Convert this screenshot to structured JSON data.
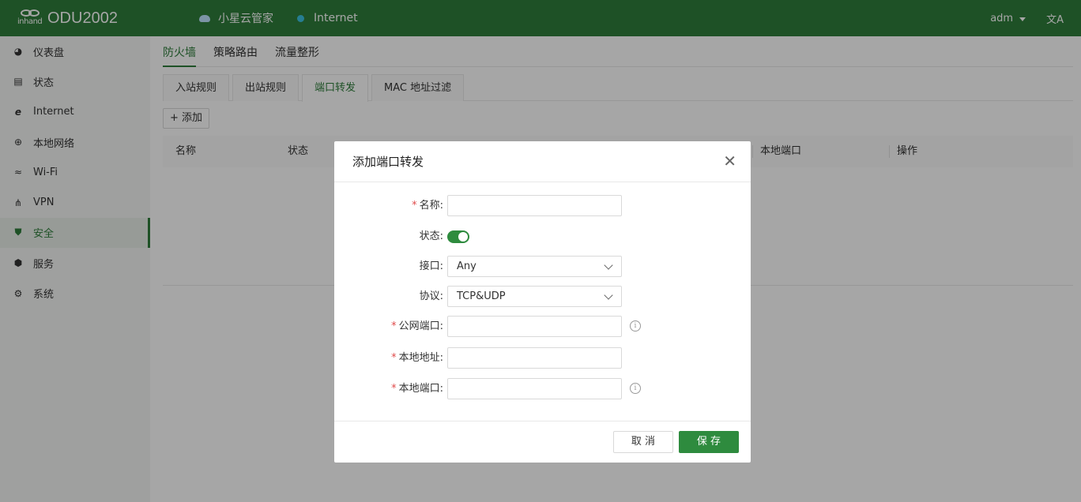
{
  "header": {
    "logo_brand": "inhand",
    "title": "ODU2002",
    "cloud_label": "小星云管家",
    "internet_label": "Internet",
    "user": "adm",
    "lang_icon": "translate-icon"
  },
  "sidebar": {
    "items": [
      {
        "label": "仪表盘",
        "icon": "dashboard-icon"
      },
      {
        "label": "状态",
        "icon": "status-icon"
      },
      {
        "label": "Internet",
        "icon": "internet-icon"
      },
      {
        "label": "本地网络",
        "icon": "globe-icon"
      },
      {
        "label": "Wi-Fi",
        "icon": "wifi-icon"
      },
      {
        "label": "VPN",
        "icon": "vpn-icon"
      },
      {
        "label": "安全",
        "icon": "shield-icon",
        "active": true
      },
      {
        "label": "服务",
        "icon": "cube-icon"
      },
      {
        "label": "系统",
        "icon": "gear-icon"
      }
    ]
  },
  "main": {
    "top_tabs": [
      "防火墙",
      "策略路由",
      "流量整形"
    ],
    "active_top_tab": "防火墙",
    "sub_tabs": [
      "入站规则",
      "出站规则",
      "端口转发",
      "MAC 地址过滤"
    ],
    "active_sub_tab": "端口转发",
    "add_label": "+ 添加",
    "table_columns": [
      "名称",
      "状态",
      "本地端口",
      "操作"
    ]
  },
  "modal": {
    "title": "添加端口转发",
    "fields": {
      "name_label": "名称:",
      "status_label": "状态:",
      "status_on": true,
      "interface_label": "接口:",
      "interface_value": "Any",
      "protocol_label": "协议:",
      "protocol_value": "TCP&UDP",
      "public_port_label": "公网端口:",
      "local_addr_label": "本地地址:",
      "local_port_label": "本地端口:"
    },
    "cancel_label": "取 消",
    "save_label": "保 存"
  },
  "colors": {
    "brand_green": "#2e7d3b",
    "button_green": "#2e8b3e",
    "required_red": "#e04b4b"
  }
}
